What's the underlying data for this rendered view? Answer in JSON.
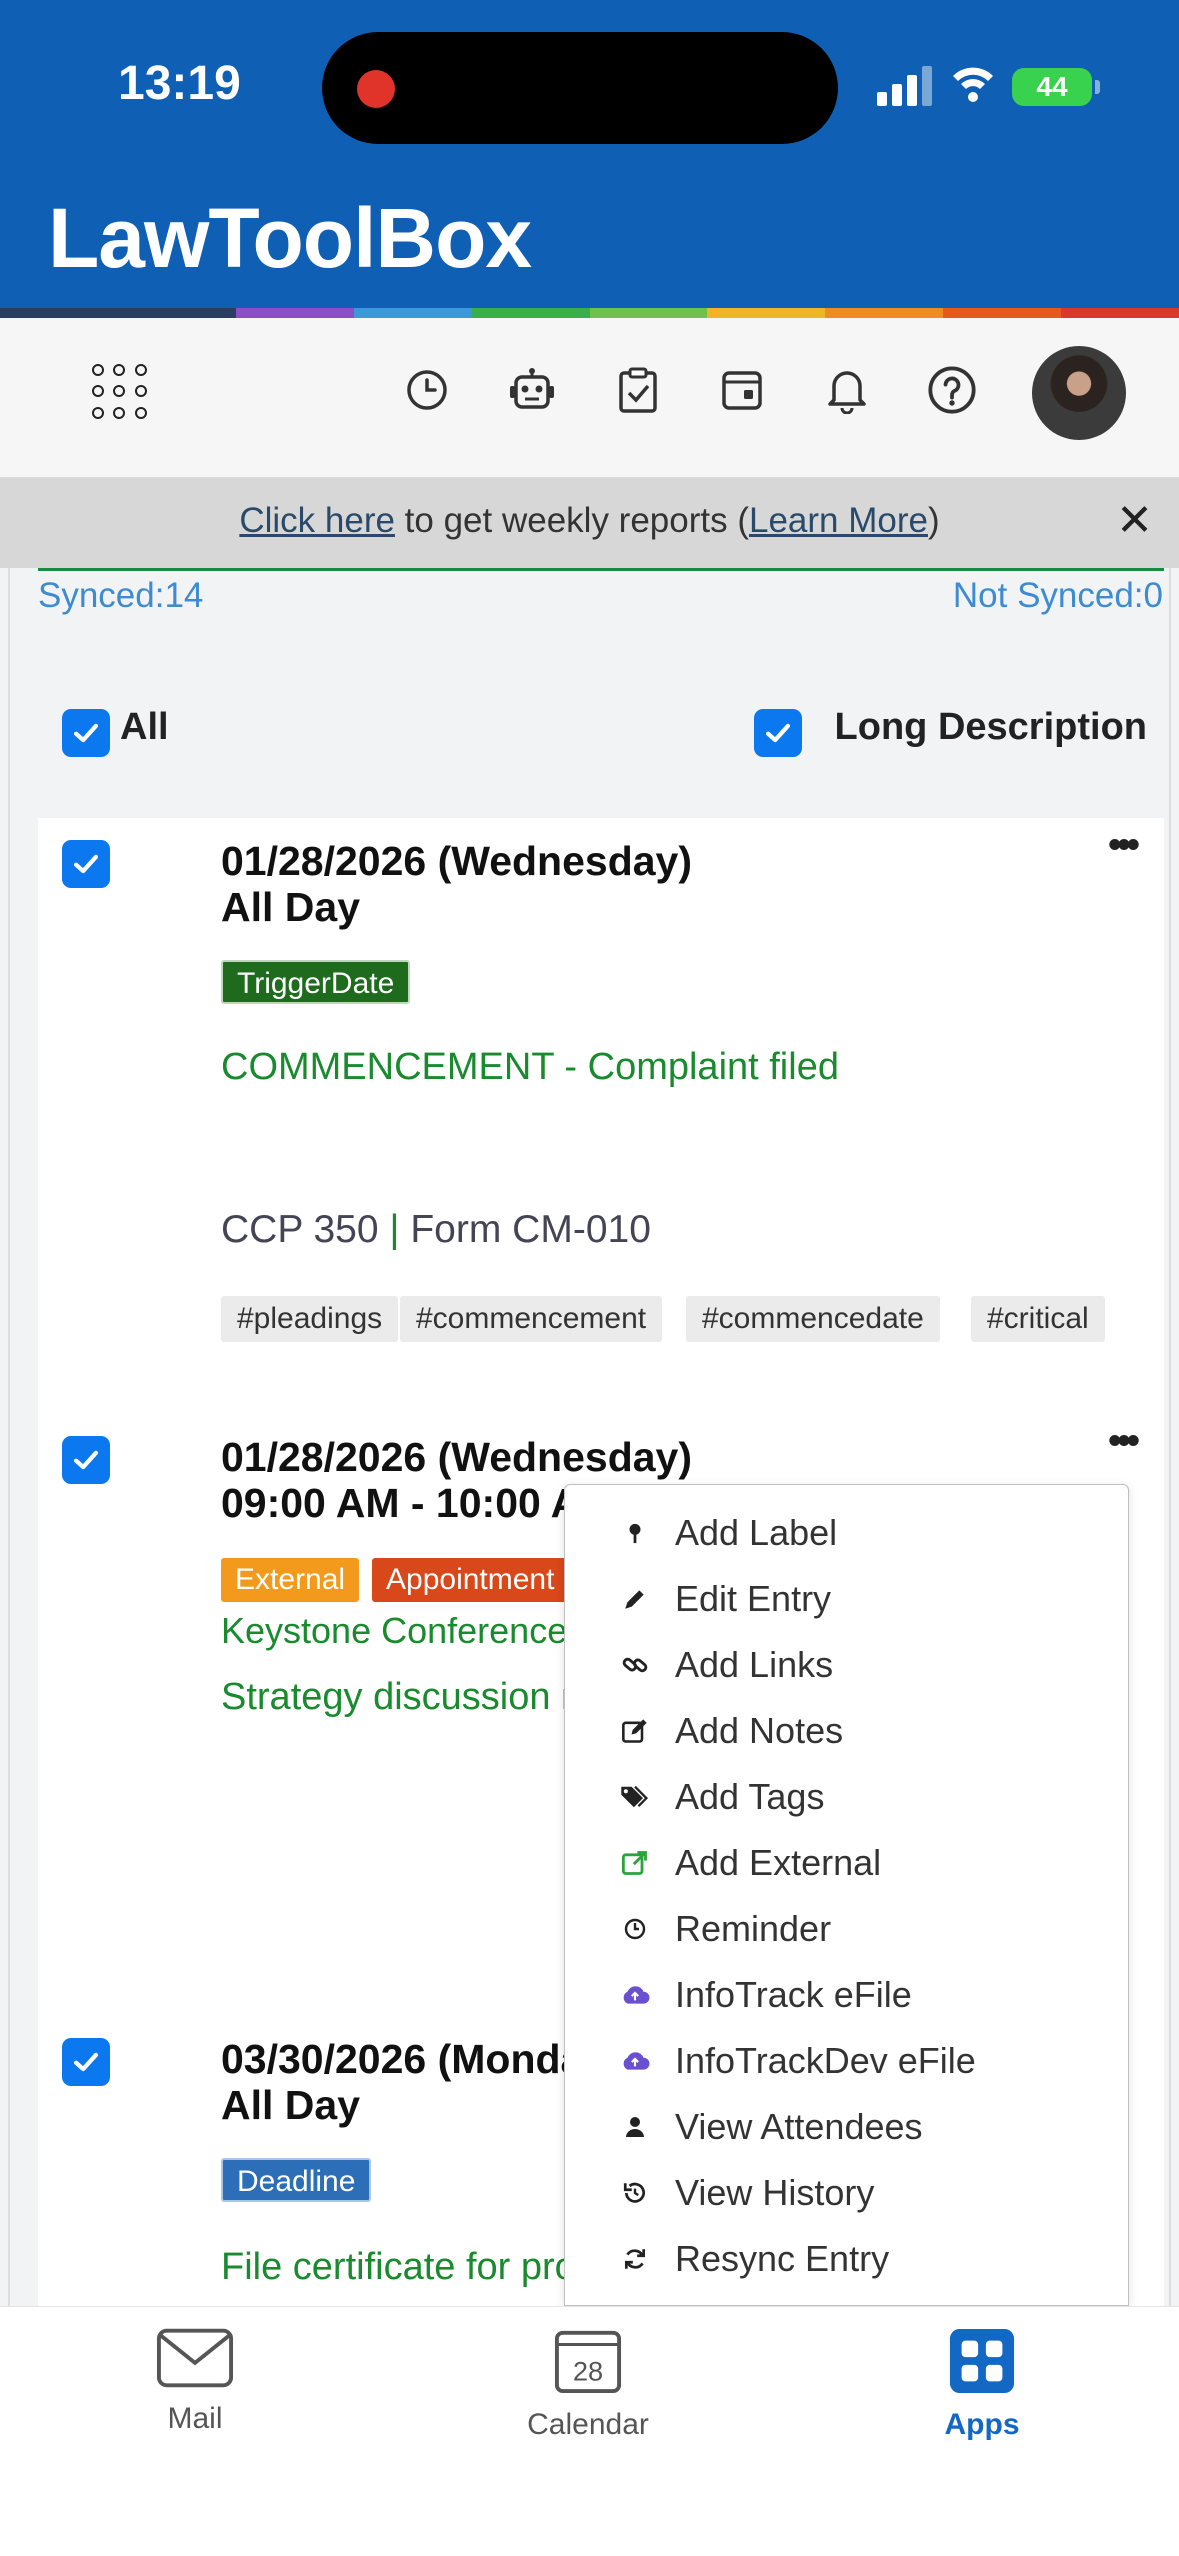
{
  "status_bar": {
    "time": "13:19",
    "battery": "44"
  },
  "app": {
    "title": "LawToolBox"
  },
  "rainbow_colors": [
    "#2a3f5f",
    "#2a3f5f",
    "#8a4fc8",
    "#3a9ad9",
    "#38b04a",
    "#6cc24a",
    "#f0b429",
    "#f08a24",
    "#e55a1b",
    "#d83a2a"
  ],
  "toolbar": {
    "icons": [
      "apps-grid-icon",
      "history-clock-icon",
      "robot-icon",
      "clipboard-check-icon",
      "calendar-box-icon",
      "bell-icon",
      "help-icon"
    ]
  },
  "banner": {
    "link": "Click here",
    "text": " to get weekly reports (",
    "learn_more": "Learn More",
    "close_paren": ")",
    "close": "✕"
  },
  "sync": {
    "synced": "Synced:14",
    "not_synced": "Not Synced:0"
  },
  "filters": {
    "all": "All",
    "long_description": "Long Description"
  },
  "events": [
    {
      "date": "01/28/2026 (Wednesday)",
      "time": "All Day",
      "badges": [
        {
          "label": "TriggerDate",
          "color": "#1e6b1e"
        }
      ],
      "title": "COMMENCEMENT - Complaint filed",
      "rule": "CCP 350",
      "sep": " | ",
      "form": "Form CM-010",
      "hashtags": [
        "#pleadings",
        "#commencement",
        "#commencedate",
        "#critical"
      ]
    },
    {
      "date": "01/28/2026 (Wednesday)",
      "time": "09:00 AM - 10:00 AM",
      "badges": [
        {
          "label": "External",
          "color": "#f39a1d"
        },
        {
          "label": "Appointment",
          "color": "#d9481a"
        }
      ],
      "location": "Keystone Conference R",
      "description": "Strategy discussion m"
    },
    {
      "date": "03/30/2026 (Monda",
      "time": "All Day",
      "badges": [
        {
          "label": "Deadline",
          "color": "#2c6fb8"
        }
      ],
      "title": "File certificate for pro"
    }
  ],
  "context_menu": [
    {
      "label": "Add Label",
      "icon": "pin-icon"
    },
    {
      "label": "Edit Entry",
      "icon": "pencil-icon"
    },
    {
      "label": "Add Links",
      "icon": "link-icon"
    },
    {
      "label": "Add Notes",
      "icon": "note-edit-icon"
    },
    {
      "label": "Add Tags",
      "icon": "tags-icon"
    },
    {
      "label": "Add External",
      "icon": "external-link-icon"
    },
    {
      "label": "Reminder",
      "icon": "clock-icon"
    },
    {
      "label": "InfoTrack eFile",
      "icon": "cloud-upload-icon"
    },
    {
      "label": "InfoTrackDev eFile",
      "icon": "cloud-upload-icon"
    },
    {
      "label": "View Attendees",
      "icon": "person-icon"
    },
    {
      "label": "View History",
      "icon": "history-icon"
    },
    {
      "label": "Resync Entry",
      "icon": "sync-icon"
    }
  ],
  "tabbar": {
    "mail": "Mail",
    "calendar": "Calendar",
    "calendar_day": "28",
    "apps": "Apps"
  }
}
